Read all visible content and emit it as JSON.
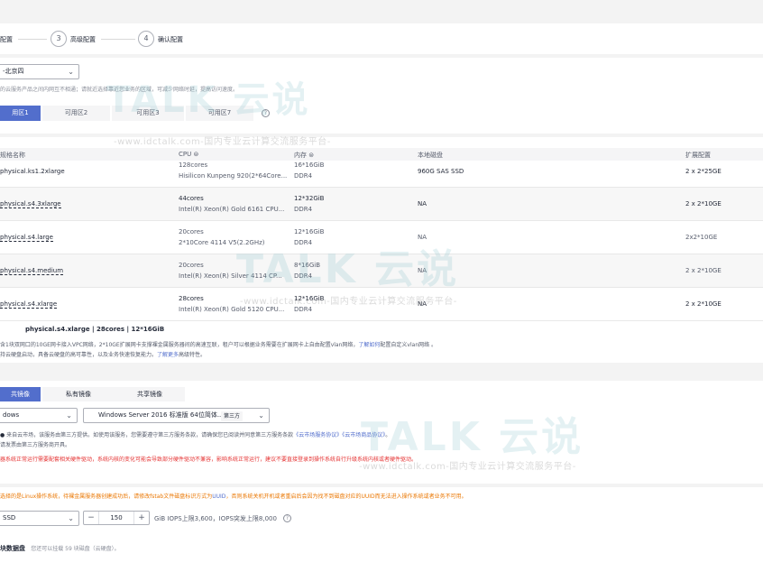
{
  "steps": [
    {
      "num": "",
      "label": "配置"
    },
    {
      "num": "3",
      "label": "高级配置"
    },
    {
      "num": "4",
      "label": "确认配置"
    }
  ],
  "region": {
    "select_value": "-北京四",
    "hint": "的云服务产品之间内网互不相通；请就近选择靠近您业务的区域，可减少网络时延，提高访问速度。",
    "az_tabs": [
      "用区1",
      "可用区2",
      "可用区3",
      "可用区7"
    ],
    "help": "?"
  },
  "flavors": {
    "headers": {
      "name": "规格名称",
      "cpu": "CPU ⊜",
      "memory": "内存 ⊜",
      "disk": "本地磁盘",
      "ext": "扩展配置"
    },
    "rows": [
      {
        "name": "physical.ks1.2xlarge",
        "cpu": "128cores",
        "cpu_sub": "Hisilicon Kunpeng 920(2*64Core...",
        "mem": "16*16GiB",
        "mem_sub": "DDR4",
        "disk": "960G SAS SSD",
        "ext": "2 x 2*25GE"
      },
      {
        "name": "physical.s4.3xlarge",
        "cpu": "44cores",
        "cpu_sub": "Intel(R) Xeon(R) Gold 6161 CPU...",
        "mem": "12*32GiB",
        "mem_sub": "DDR4",
        "disk": "NA",
        "ext": "2 x 2*10GE"
      },
      {
        "name": "physical.s4.large",
        "cpu": "20cores",
        "cpu_sub": "2*10Core 4114 V5(2.2GHz)",
        "mem": "12*16GiB",
        "mem_sub": "DDR4",
        "disk": "NA",
        "ext": "2x2*10GE"
      },
      {
        "name": "physical.s4.medium",
        "cpu": "20cores",
        "cpu_sub": "Intel(R) Xeon(R) Silver 4114 CP...",
        "mem": "8*16GiB",
        "mem_sub": "DDR4",
        "disk": "NA",
        "ext": "2 x 2*10GE"
      },
      {
        "name": "physical.s4.xlarge",
        "cpu": "28cores",
        "cpu_sub": "Intel(R) Xeon(R) Gold 5120 CPU...",
        "mem": "12*16GiB",
        "mem_sub": "DDR4",
        "disk": "NA",
        "ext": "2 x 2*10GE"
      }
    ],
    "selected_summary": "physical.s4.xlarge | 28cores | 12*16GiB",
    "desc1_pre": "含1块双网口的10GE网卡接入VPC网络，2*10GE扩展网卡支撑裸金属服务器间的高速互联，租户可以根据业务需要在扩展网卡上自由配置vlan网络，",
    "desc1_link": "了解如何",
    "desc1_post": "配置自定义vlan网络 。",
    "desc2_pre": "持云硬盘启动，具备云硬盘的高可靠性，以及业务快速恢复能力。",
    "desc2_link": "了解更多",
    "desc2_post": "高级特性。"
  },
  "image": {
    "tabs": [
      "共镜像",
      "私有镜像",
      "共享镜像"
    ],
    "os_value": "dows",
    "version_value": "Windows Server 2016 标准版 64位简体...",
    "version_tag": "第三方",
    "note1_pre": "来自云市场，该服务由第三方提供。如使用该服务，您需要遵守第三方服务条款，请确保您已阅读并同意第三方服务条款",
    "note1_link1": "《云市场服务协议》",
    "note1_link2": "《云市场商品协议》",
    "note1_post": "。",
    "note1_b": "请发票由第三方服务商开具。",
    "warn_red": "器系统正常运行需要配套相关硬件驱动，系统内核的变化可能会导致部分硬件驱动不兼容，影响系统正常运行，建议不要直接登录到操作系统自行升级系统内核或者硬件驱动。",
    "watermark_text": "-www.idctalk.com-国内专业云计算交流服务平台-"
  },
  "disk": {
    "warn_orange_pre": "选择的是Linux操作系统，待裸金属服务器创建成功后，请修改fstab文件磁盘标识方式为",
    "warn_uuid1": "UUID",
    "warn_orange_post": "，否则系统关机开机或者重启后会因为找不到磁盘对应的UUID而无法进入操作系统或者业务不可用。",
    "type_value": "SSD",
    "size_value": "150",
    "minus": "−",
    "plus": "+",
    "iops": "GiB IOPS上限3,600，IOPS突发上限8,000",
    "help": "?",
    "add_label": "块数据盘",
    "add_hint": "您还可以挂载 59 块磁盘（云硬盘）。"
  },
  "watermarks": {
    "logo_text": "TALK 云说",
    "site_text": "-www.idctalk.com-国内专业云计算交流服务平台-"
  }
}
